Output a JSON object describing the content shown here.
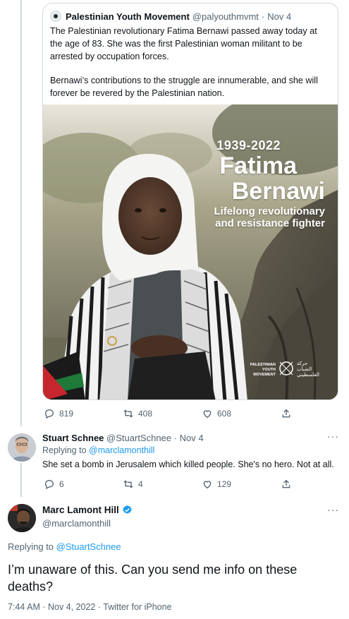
{
  "quoted_tweet": {
    "author_name": "Palestinian Youth Movement",
    "author_handle": "@palyouthmvmt",
    "date": "Nov 4",
    "paragraph1": "The Palestinian revolutionary Fatima Bernawi passed away today at the age of 83. She was the first Palestinian woman militant to be arrested by occupation forces.",
    "paragraph2": "Bernawi’s contributions to the struggle are innumerable, and she will forever be revered by the Palestinian nation.",
    "poster": {
      "years": "1939-2022",
      "first_name": "Fatima",
      "last_name": "Bernawi",
      "tagline_line1": "Lifelong revolutionary",
      "tagline_line2": "and resistance fighter",
      "logo_line1": "PALESTINIAN",
      "logo_line2": "YOUTH",
      "logo_line3": "MOVEMENT",
      "logo_arabic_line1": "حركة",
      "logo_arabic_line2": "الشباب",
      "logo_arabic_line3": "الفلسطيني"
    },
    "actions": {
      "replies": "819",
      "retweets": "408",
      "likes": "608"
    }
  },
  "reply_tweet": {
    "author_name": "Stuart Schnee",
    "author_handle": "@StuartSchnee",
    "date": "Nov 4",
    "replying_prefix": "Replying to",
    "replying_to": "@marclamonthill",
    "text": "She set a bomb in Jerusalem which killed people. She's no hero. Not at all.",
    "actions": {
      "replies": "6",
      "retweets": "4",
      "likes": "129"
    }
  },
  "main_tweet": {
    "author_name": "Marc Lamont Hill",
    "author_handle": "@marclamonthill",
    "replying_prefix": "Replying to",
    "replying_to": "@StuartSchnee",
    "text": "I’m unaware of this. Can you send me info on these deaths?",
    "timestamp": "7:44 AM · Nov 4, 2022 · Twitter for iPhone"
  },
  "colors": {
    "link": "#1d9bf0",
    "secondary_text": "#536471",
    "verified": "#1d9bf0"
  }
}
